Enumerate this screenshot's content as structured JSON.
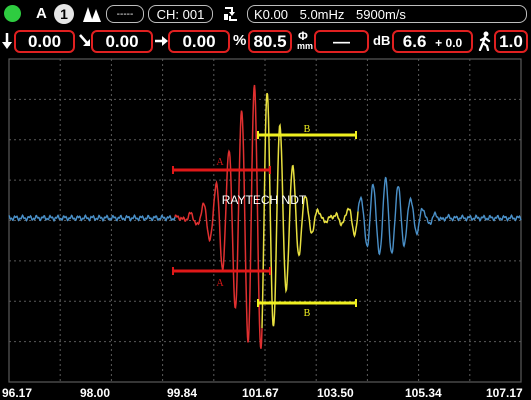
{
  "top_bar": {
    "status_color": "#2ecc40",
    "gate_letter": "A",
    "gate_number": "1",
    "mode_box": "-----",
    "channel": "CH: 001",
    "probe": "K0.00",
    "frequency": "5.0mHz",
    "velocity": "5900m/s"
  },
  "measure_bar": {
    "depth": "0.00",
    "surface_distance": "0.00",
    "horizontal_distance": "0.00",
    "percent_unit": "%",
    "amplitude": "80.5",
    "phi_label": "Φ",
    "phi_sub": "mm",
    "phi_value": "—",
    "db_label": "dB",
    "gain": "6.6",
    "gain_offset": "+ 0.0",
    "step": "1.0"
  },
  "screen": {
    "watermark": "RAYTECH NDT",
    "gate_a_label": "A",
    "gate_b_label": "B"
  },
  "x_axis": {
    "ticks": [
      "96.17",
      "98.00",
      "99.84",
      "101.67",
      "103.50",
      "105.34",
      "107.17"
    ]
  },
  "colors": {
    "trace_blue": "#4a90c8",
    "trace_red": "#e03030",
    "trace_yellow": "#e8e040",
    "gate_red": "#e01818",
    "gate_yellow": "#f0f020",
    "grid": "#5a5a5a"
  }
}
